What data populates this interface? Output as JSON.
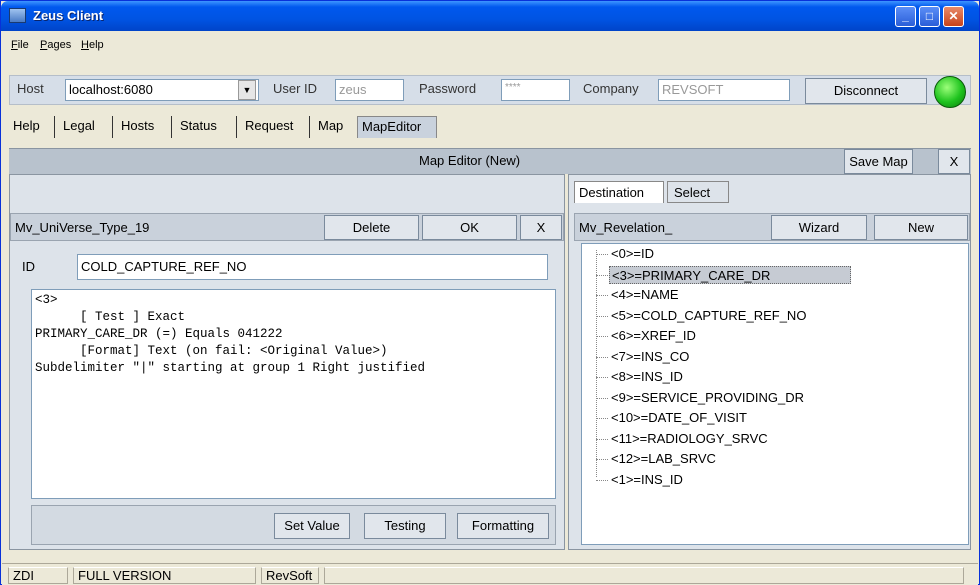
{
  "window": {
    "title": "Zeus Client"
  },
  "menu": [
    {
      "label": "File",
      "u": "F",
      "rest": "ile"
    },
    {
      "label": "Pages",
      "u": "P",
      "rest": "ages"
    },
    {
      "label": "Help",
      "u": "H",
      "rest": "elp"
    }
  ],
  "connection": {
    "host_label": "Host",
    "host_value": "localhost:6080",
    "userid_label": "User ID",
    "userid_value": "zeus",
    "password_label": "Password",
    "password_value": "****",
    "company_label": "Company",
    "company_value": "REVSOFT",
    "disconnect_label": "Disconnect",
    "status_color": "#1ec31e"
  },
  "tabs": [
    "Help",
    "Legal",
    "Hosts",
    "Status",
    "Request",
    "Map",
    "MapEditor"
  ],
  "active_tab": "MapEditor",
  "editor": {
    "title": "Map Editor (New)",
    "save_label": "Save Map",
    "close_label": "X"
  },
  "left": {
    "item_name": "Mv_UniVerse_Type_19",
    "delete_label": "Delete",
    "ok_label": "OK",
    "close_label": "X",
    "id_label": "ID",
    "id_value": "COLD_CAPTURE_REF_NO",
    "text_lines": [
      "<3>",
      "      [ Test ] Exact",
      "PRIMARY_CARE_DR (=) Equals 041222",
      "      [Format] Text (on fail: <Original Value>)",
      "Subdelimiter \"|\" starting at group 1 Right justified"
    ],
    "setvalue_label": "Set Value",
    "testing_label": "Testing",
    "formatting_label": "Formatting"
  },
  "right": {
    "tab_destination": "Destination",
    "tab_select": "Select",
    "item_name": "Mv_Revelation_",
    "wizard_label": "Wizard",
    "new_label": "New",
    "tree_items": [
      "<0>=ID",
      "<3>=PRIMARY_CARE_DR",
      "<4>=NAME",
      "<5>=COLD_CAPTURE_REF_NO",
      "<6>=XREF_ID",
      "<7>=INS_CO",
      "<8>=INS_ID",
      "<9>=SERVICE_PROVIDING_DR",
      "<10>=DATE_OF_VISIT",
      "<11>=RADIOLOGY_SRVC",
      "<12>=LAB_SRVC",
      "<1>=INS_ID"
    ],
    "selected_index": 1
  },
  "status": {
    "cell1": "ZDI",
    "cell2": "FULL VERSION",
    "cell3": "RevSoft"
  }
}
